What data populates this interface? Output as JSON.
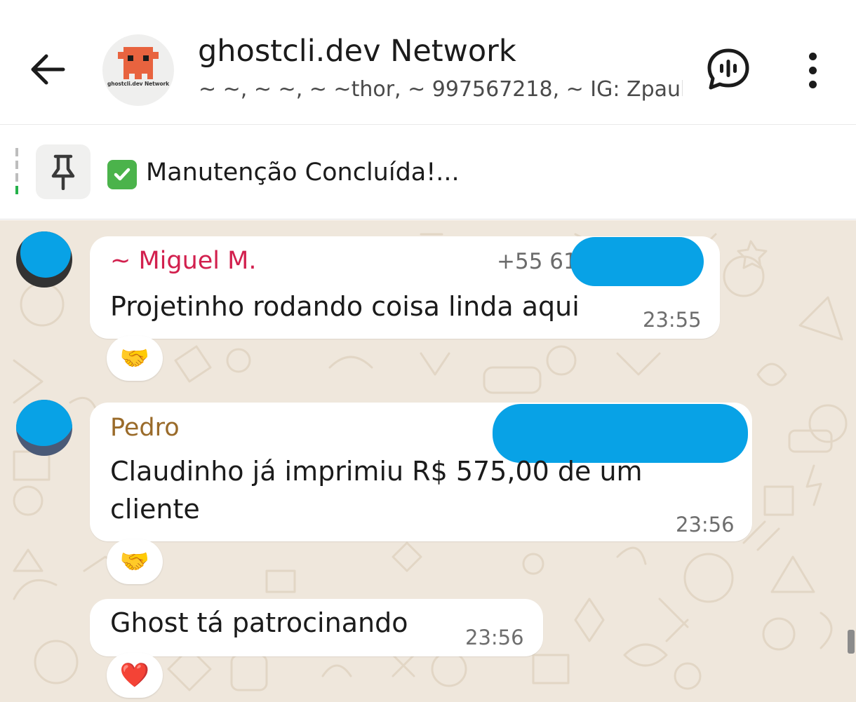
{
  "header": {
    "title": "ghostcli.dev Network",
    "members": "~ ~, ~ ~, ~ ~thor, ~ 997567218, ~ IG: Zpaul...",
    "avatar_label": "ghostcli.dev Network",
    "back_icon": "back-arrow-icon",
    "voice_icon": "voice-chat-icon",
    "more_icon": "more-vertical-icon"
  },
  "pinned": {
    "text": "Manutenção Concluída!...",
    "icon": "pin-icon",
    "badge_icon": "check-mark-icon",
    "badge_color": "#4bb34b"
  },
  "messages": [
    {
      "sender": "~ Miguel M.",
      "sender_color": "#d2204e",
      "phone": "+55 61",
      "text": "Projetinho rodando coisa linda aqui",
      "time": "23:55",
      "reaction": "🤝"
    },
    {
      "sender": "Pedro",
      "sender_color": "#9a6b2a",
      "text": "Claudinho já imprimiu R$ 575,00 de um cliente",
      "time": "23:56",
      "reaction": "🤝"
    },
    {
      "text": "Ghost tá patrocinando",
      "time": "23:56",
      "reaction": "❤️"
    }
  ],
  "colors": {
    "chat_background": "#efe7dc",
    "bubble": "#ffffff",
    "redaction": "#08a2e6"
  }
}
